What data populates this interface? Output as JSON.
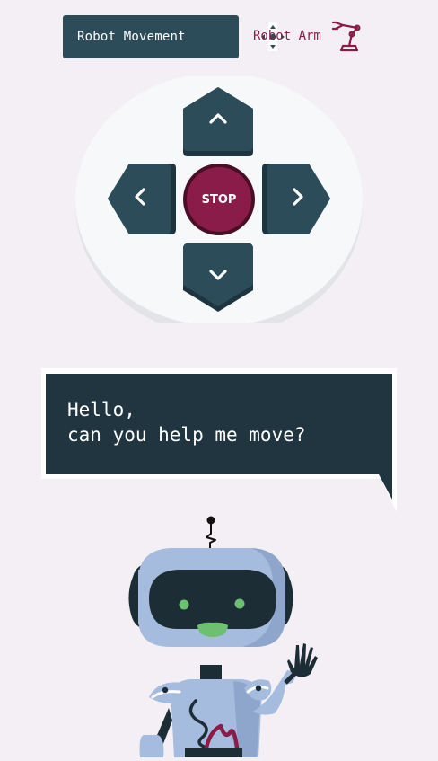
{
  "tabs": {
    "movement_label": "Robot Movement",
    "movement_icon": "dpad-icon",
    "arm_label": "Robot Arm",
    "arm_icon": "robot-arm-icon"
  },
  "controls": {
    "stop_label": "STOP",
    "up_icon": "chevron-up-icon",
    "down_icon": "chevron-down-icon",
    "left_icon": "chevron-left-icon",
    "right_icon": "chevron-right-icon"
  },
  "speech": {
    "line1": "Hello,",
    "line2": "can you help me move?"
  },
  "colors": {
    "background": "#f4eff4",
    "primary": "#2c4c59",
    "accent": "#8a1c4a",
    "bubble": "#213540",
    "robot_body": "#a6bcdf"
  }
}
